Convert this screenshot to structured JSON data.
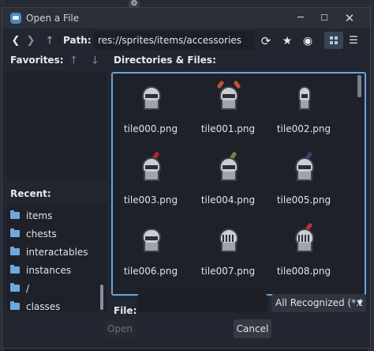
{
  "window": {
    "title": "Open a File"
  },
  "toolbar": {
    "back_icon": "❮",
    "forward_icon": "❯",
    "up_icon": "🡑",
    "path_label": "Path:",
    "path_value": "res://sprites/items/accessories",
    "refresh_icon": "⟳",
    "favorite_icon": "★",
    "hidden_icon": "◉",
    "list_icon": "☰"
  },
  "sidebar": {
    "favorites_label": "Favorites:",
    "recent_label": "Recent:",
    "recent_items": [
      "items",
      "chests",
      "interactables",
      "instances",
      "/",
      "classes"
    ]
  },
  "files": {
    "label": "Directories & Files:",
    "items": [
      {
        "name": "tile000.png",
        "plume": "",
        "shape": "dome"
      },
      {
        "name": "tile001.png",
        "plume": "#c0542d",
        "shape": "horned"
      },
      {
        "name": "tile002.png",
        "plume": "",
        "shape": "narrow"
      },
      {
        "name": "tile003.png",
        "plume": "#b3262d",
        "shape": "dome"
      },
      {
        "name": "tile004.png",
        "plume": "#6b8a3a",
        "shape": "dome"
      },
      {
        "name": "tile005.png",
        "plume": "#3a3f7a",
        "shape": "dome"
      },
      {
        "name": "tile006.png",
        "plume": "",
        "shape": "round"
      },
      {
        "name": "tile007.png",
        "plume": "",
        "shape": "barred"
      },
      {
        "name": "tile008.png",
        "plume": "#c0303a",
        "shape": "barred"
      }
    ]
  },
  "footer": {
    "file_label": "File:",
    "file_value": "",
    "filter_value": "All Recognized (*.t",
    "open_label": "Open",
    "cancel_label": "Cancel"
  },
  "colors": {
    "accent": "#6aa2dc",
    "folder": "#6fa8dc",
    "window_bg": "#222630"
  }
}
